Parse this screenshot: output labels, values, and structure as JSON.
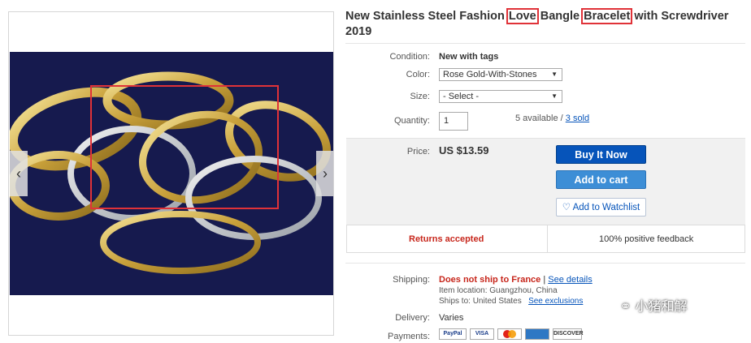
{
  "title": {
    "part1": "New Stainless Steel Fashion ",
    "love": "Love",
    "part2": " Bangle ",
    "bracelet": "Bracelet",
    "part3": " with Screwdriver 2019"
  },
  "condition": {
    "label": "Condition:",
    "value": "New with tags"
  },
  "color": {
    "label": "Color:",
    "selected": "Rose Gold-With-Stones"
  },
  "size": {
    "label": "Size:",
    "selected": "- Select -"
  },
  "quantity": {
    "label": "Quantity:",
    "value": "1",
    "available": "5 available / ",
    "sold": "3 sold"
  },
  "price": {
    "label": "Price:",
    "value": "US $13.59"
  },
  "buttons": {
    "buy_now": "Buy It Now",
    "add_cart": "Add to cart",
    "watchlist": "Add to Watchlist"
  },
  "returns": {
    "text": "Returns accepted",
    "feedback": "100% positive feedback"
  },
  "shipping": {
    "label": "Shipping:",
    "status": "Does not ship to France",
    "divider": " | ",
    "see_details": "See details",
    "item_location": "Item location:  Guangzhou, China",
    "ships_to": "Ships to:  United States",
    "see_exclusions": "See exclusions"
  },
  "delivery": {
    "label": "Delivery:",
    "value": "Varies"
  },
  "payments": {
    "label": "Payments:",
    "methods": [
      "PayPal",
      "VISA",
      "",
      "",
      "DISCOVER"
    ]
  },
  "watermark": "小猪和解",
  "colors": {
    "buy": "#0654ba",
    "cart": "#3d8ed6",
    "highlight": "#e03238",
    "photo_bg": "#161a4e"
  }
}
